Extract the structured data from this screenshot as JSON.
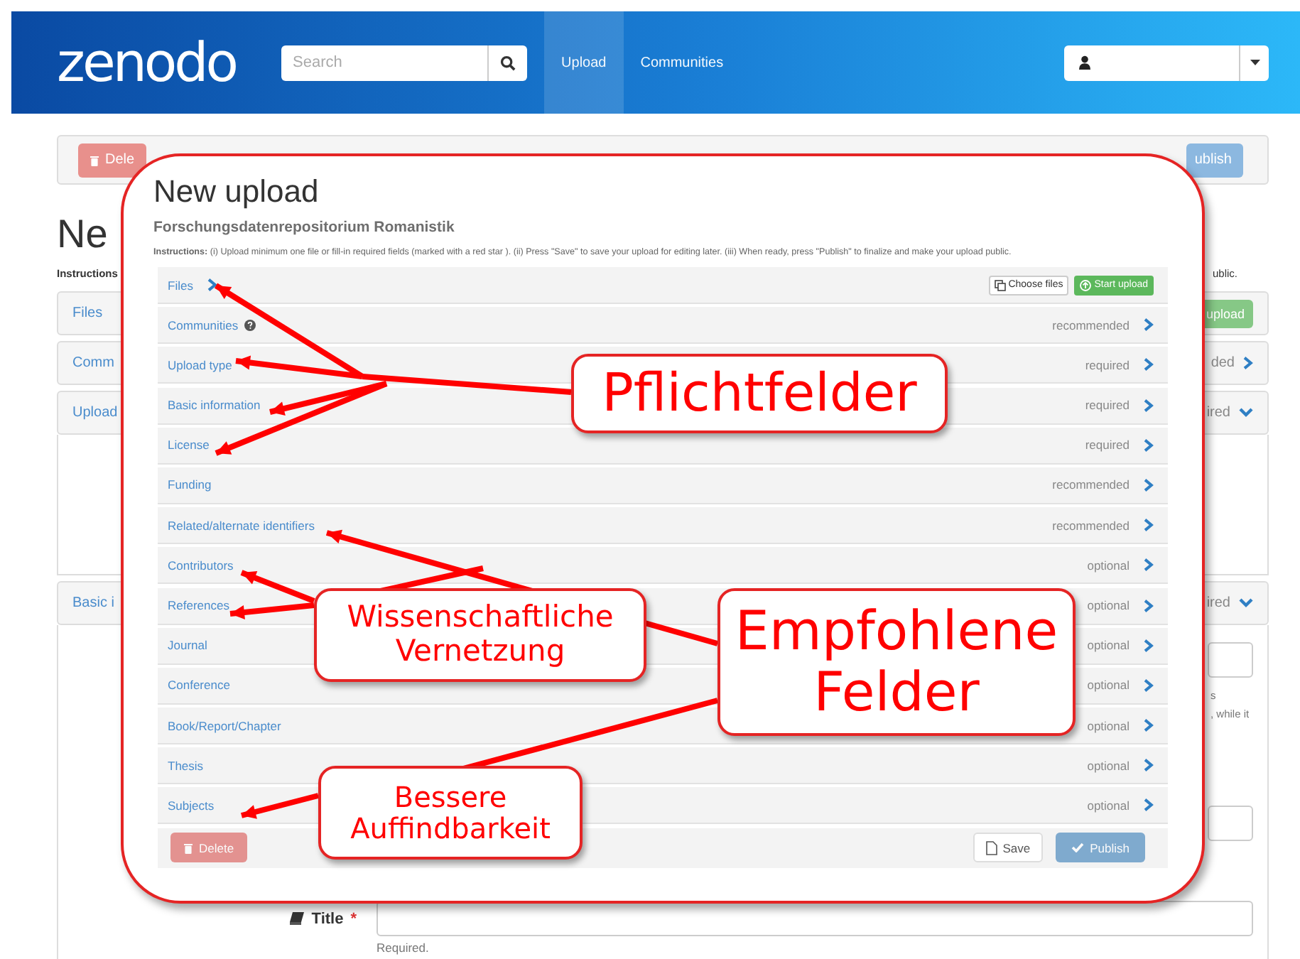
{
  "navbar": {
    "logo": "zenodo",
    "search": {
      "placeholder": "Search"
    },
    "links": [
      {
        "label": "Upload",
        "selected": true
      },
      {
        "label": "Communities",
        "selected": false
      }
    ]
  },
  "background_page": {
    "toolbar": {
      "delete": "Dele",
      "publish": "ublish"
    },
    "heading": "Ne",
    "instructions": "Instructions",
    "instructions_end": "ublic.",
    "files_panel": {
      "label": "Files",
      "button": "upload"
    },
    "panels": [
      {
        "label": "Comm",
        "status": "ded",
        "expanded": false
      },
      {
        "label": "Upload",
        "status": "ired",
        "expanded": true
      },
      {
        "label": "Basic i",
        "status": "ired",
        "expanded": true
      }
    ],
    "help_text": [
      "s",
      ", while it"
    ],
    "title_field": {
      "label": "Title",
      "required_mark": "*",
      "help": "Required."
    }
  },
  "upload_dialog": {
    "title": "New upload",
    "subtitle": "Forschungsdatenrepositorium Romanistik",
    "instructions": "**Instructions:** (i) Upload minimum one file or fill-in required fields (marked with a red star ). (ii) Press \"Save\" to save your upload for editing later. (iii) When ready, press \"Publish\" to finalize and make your upload public.",
    "sections": [
      {
        "label": "Files",
        "kind": "files",
        "buttons": [
          "Choose files",
          "Start upload"
        ]
      },
      {
        "label": "Communities",
        "kind": "help",
        "status": "recommended"
      },
      {
        "label": "Upload type",
        "kind": "plain",
        "status": "required"
      },
      {
        "label": "Basic information",
        "kind": "plain",
        "status": "required"
      },
      {
        "label": "License",
        "kind": "plain",
        "status": "required"
      },
      {
        "label": "Funding",
        "kind": "plain",
        "status": "recommended"
      },
      {
        "label": "Related/alternate identifiers",
        "kind": "plain",
        "status": "recommended"
      },
      {
        "label": "Contributors",
        "kind": "plain",
        "status": "optional"
      },
      {
        "label": "References",
        "kind": "plain",
        "status": "optional"
      },
      {
        "label": "Journal",
        "kind": "plain",
        "status": "optional"
      },
      {
        "label": "Conference",
        "kind": "plain",
        "status": "optional"
      },
      {
        "label": "Book/Report/Chapter",
        "kind": "plain",
        "status": "optional"
      },
      {
        "label": "Thesis",
        "kind": "plain",
        "status": "optional"
      },
      {
        "label": "Subjects",
        "kind": "plain",
        "status": "optional"
      }
    ],
    "footer_buttons": [
      {
        "label": "Delete",
        "kind": "danger",
        "disabled": true
      },
      {
        "label": "Save",
        "kind": "default",
        "disabled": false
      },
      {
        "label": "Publish",
        "kind": "primary",
        "disabled": true
      }
    ]
  },
  "annotations": [
    {
      "text": "Pflichtfelder"
    },
    {
      "text": "Wissenschaftliche Vernetzung"
    },
    {
      "text": "Empfohlene Felder"
    },
    {
      "text": "Bessere Auffindbarkeit"
    }
  ]
}
